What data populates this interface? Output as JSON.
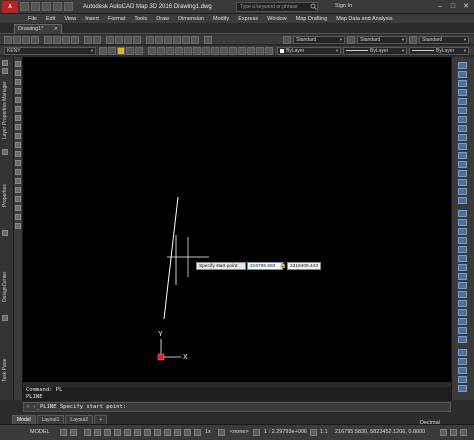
{
  "titlebar": {
    "app_badge": "A",
    "title": "Autodesk AutoCAD Map 3D 2016    Drawing1.dwg",
    "search_placeholder": "Type a keyword or phrase",
    "sign_in": "Sign In",
    "minimize": "–",
    "maximize": "□",
    "close": "✕"
  },
  "menu": [
    "File",
    "Edit",
    "View",
    "Insert",
    "Format",
    "Tools",
    "Draw",
    "Dimension",
    "Modify",
    "Express",
    "Window",
    "Map Drafting",
    "Map Data and Analysis"
  ],
  "file_tab": {
    "label": "Drawing1*",
    "close": "✕"
  },
  "toolbar": {
    "text_style": "Standard",
    "dim_style": "Standard",
    "table_style": "Standard",
    "layer": "KENY",
    "color": "ByLayer",
    "linetype": "ByLayer",
    "lineweight": "ByLayer"
  },
  "palettes": {
    "layer_manager": "Layer Properties Manager",
    "properties": "Properties",
    "design_center": "DesignCenter",
    "task_pane": "Task Pane"
  },
  "canvas": {
    "ucs_y": "Y",
    "ucs_x": "X",
    "dyn_prompt": "Specify start point:",
    "dyn_x_value": "216795.593",
    "dyn_lock": "🔒",
    "dyn_y_value": "2319409.443"
  },
  "command": {
    "history": [
      "Command: PL",
      "PLINE"
    ],
    "prompt_icon": "›_",
    "close": "✕",
    "current": "PLINE Specify start point:"
  },
  "layout_tabs": [
    "Model",
    "Layout1",
    "Layout2",
    "+"
  ],
  "status": {
    "model": "MODEL",
    "scale": "1x",
    "none": "<none>",
    "scale_value": "1 : 2.29793e+006",
    "annoscale": "1:1",
    "coords": "216795.5830, 5823452.1206, 0.0000",
    "units": "Decimal"
  }
}
